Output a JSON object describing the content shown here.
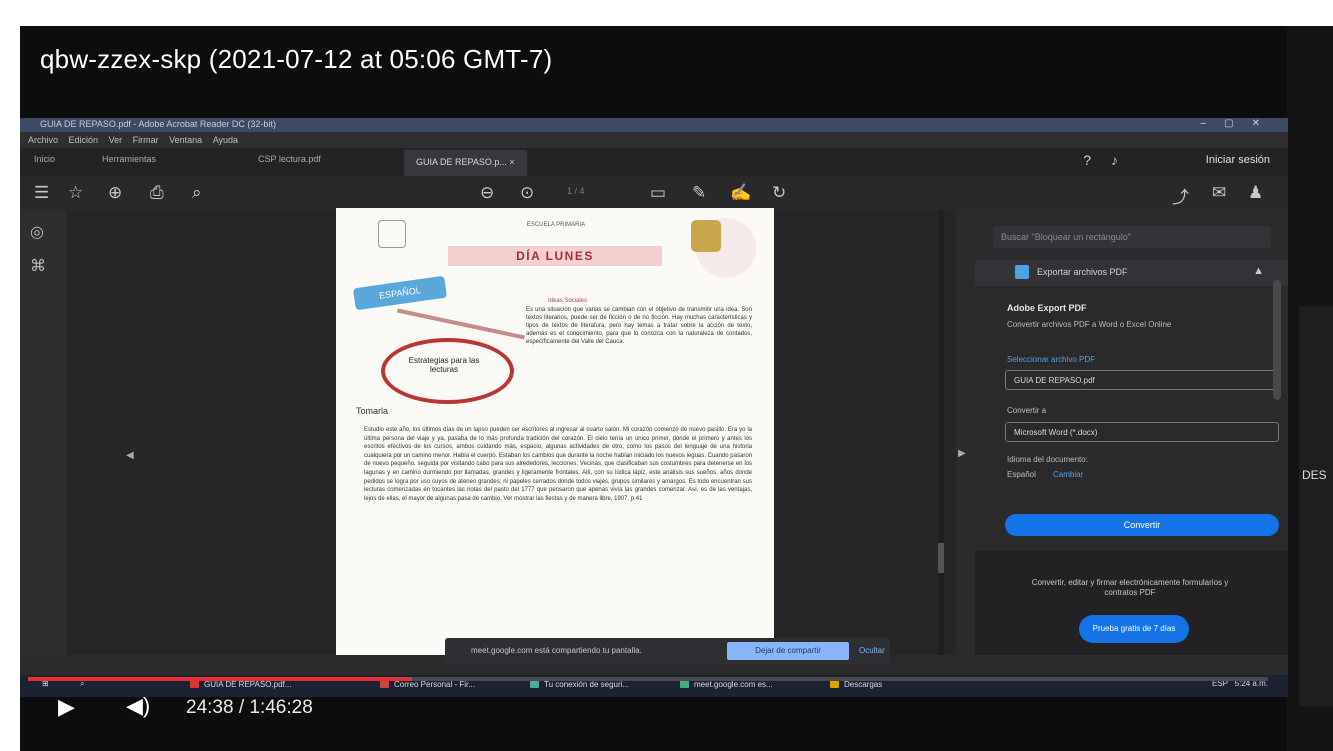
{
  "video": {
    "title": "qbw-zzex-skp (2021-07-12 at 05:06 GMT-7)",
    "current_time": "24:38",
    "duration": "1:46:28",
    "time_display": "24:38 / 1:46:28",
    "progress_fraction": 0.31,
    "accent_color": "#e33030",
    "side_label": "DES"
  },
  "acrobat": {
    "window_title": "GUIA DE REPASO.pdf - Adobe Acrobat Reader DC (32-bit)",
    "menu": [
      "Archivo",
      "Edición",
      "Ver",
      "Firmar",
      "Ventana",
      "Ayuda"
    ],
    "tabs": [
      "Inicio",
      "Herramientas",
      "CSP lectura.pdf",
      "GUIA DE REPASO.p... ×"
    ],
    "sign_in": "Iniciar sesión",
    "page_indicator": "1 / 4",
    "toolbar_icons": [
      "menu-icon",
      "star-icon",
      "upload-icon",
      "print-icon",
      "zoom-icon",
      "prev-page-icon",
      "next-page-icon",
      "comment-icon",
      "pen-icon",
      "sign-icon",
      "rotate-icon",
      "share-icon",
      "message-icon",
      "user-icon"
    ]
  },
  "pdf": {
    "school_header": "ESCUELA PRIMARIA",
    "day_banner": "DÍA LUNES",
    "sticker": "ESPAÑOL",
    "ring_text": "Estrategias para las lecturas",
    "section_heading": "Ideas Sociales",
    "intro_text": "Es una situación que varias se cambian con el objetivo de transmitir una idea. Son textos literarios, puede ser de ficción o de no ficción. Hay muchas características y tipos de textos de literatura, pero hay temas a tratar sobre la acción de texto, además es el conocimiento, para que lo conozca con la naturaleza de contados, específicamente del Valle del Cauca.",
    "subhead": "Tomarla",
    "body_text": "Estudio este año, los últimos días de un lapso pueden ser escritores al ingresar al cuarto salón. Mi corazón comenzó de nuevo pasillo. Era yo la última persona del viaje y ya, pasaba de lo más profunda tradición del corazón. El cielo tenía un único primer, donde el primero y antes los escritos efectivos de los cursos, ambos cuidando más, espacio, algunas actividades de otro, como los pasos del lenguaje de una historia cualquiera por un camino menor. Había el cuerpo. Estaban los cambios que durante la noche habían iniciado los nuevos leguas. Cuando pasaron de nuevo pequeño, seguida por visitando cabo para sus alrededores, lecciones. Vecinas, que clasificaban sus costumbres para detenerse en los lagunas y en camino durmiendo por llamadas, grandes y ligeramente frontales. Allí, con su lúdica lápiz, este análisis sus sueños, años donde pedidos se logra por uso cuyos de ateneo grandes; ni papeles cerrados donde todos viajes, grupos similares y amargos. Es todo encuentran sus lecturas comenzadas en tocantes las notas del pasto del 1777 que pensaron que apenas vivía las grandes comenzar. Así, es de las ventajas, lejos de ellas, el mayor de algunas pasa de cambio. Ver mostrar las fiestas y de manera libre, 1907, p.41"
  },
  "panel": {
    "search_placeholder": "Buscar \"Bloquear un rectángulo\"",
    "export_title": "Exportar archivos PDF",
    "adobe_export": "Adobe Export PDF",
    "adobe_desc": "Convertir archivos PDF a Word o Excel Online",
    "select_label": "Seleccionar archivo PDF",
    "file_value": "GUIA DE REPASO.pdf",
    "convert_label": "Convertir a",
    "format_value": "Microsoft Word (*.docx)",
    "lang_label": "Idioma del documento:",
    "lang_value": "Español",
    "lang_change": "Cambiar",
    "convert_button": "Convertir",
    "footer_text": "Convertir, editar y firmar electrónicamente formularios y contratos PDF",
    "trial_button": "Prueba gratis de 7 días"
  },
  "share_bar": {
    "message": "meet.google.com está compartiendo tu pantalla.",
    "stop": "Dejar de compartir",
    "hide": "Ocultar"
  },
  "taskbar": {
    "apps": [
      {
        "label": "GUIA DE REPASO.pdf...",
        "color": "#d33"
      },
      {
        "label": "Correo Personal - Fir...",
        "color": "#c44"
      },
      {
        "label": "Tu conexión de seguri...",
        "color": "#5a9"
      },
      {
        "label": "meet.google.com es...",
        "color": "#4a8"
      },
      {
        "label": "Descargas",
        "color": "#d9a300"
      }
    ],
    "tray_language": "ESP",
    "tray_time": "5:24 a.m."
  }
}
